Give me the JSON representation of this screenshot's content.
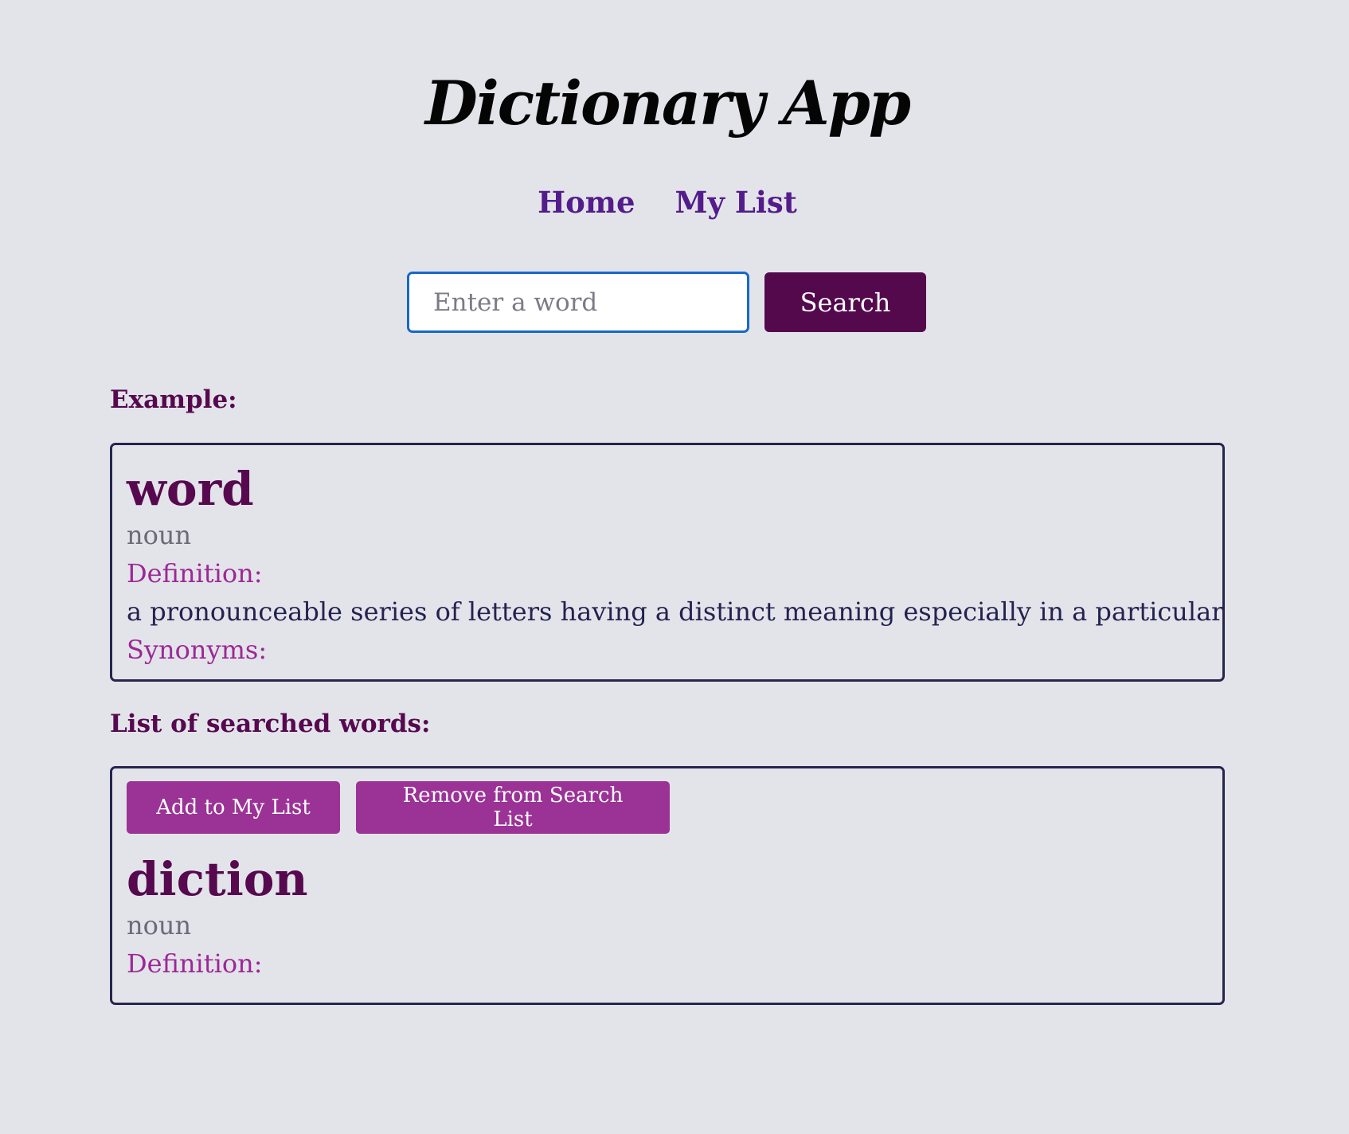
{
  "header": {
    "title": "Dictionary App"
  },
  "nav": {
    "items": [
      {
        "label": "Home"
      },
      {
        "label": "My List"
      }
    ]
  },
  "search": {
    "value": "",
    "placeholder": "Enter a word",
    "button_label": "Search"
  },
  "example": {
    "heading": "Example:",
    "word": "word",
    "part_of_speech": "noun",
    "definition_label": "Definition:",
    "definition": "a pronounceable series of letters having a distinct meaning especially in a particular field",
    "synonyms_label": "Synonyms:"
  },
  "searched": {
    "heading": "List of searched words:",
    "add_button": "Add to My List",
    "remove_button": "Remove from Search List",
    "entries": [
      {
        "word": "diction",
        "part_of_speech": "noun",
        "definition_label": "Definition:"
      }
    ]
  },
  "colors": {
    "background": "#e3e4ea",
    "nav_link": "#541c8b",
    "primary": "#54094d",
    "accent": "#9b3296",
    "label": "#9c2896",
    "text": "#232350",
    "border": "#25254f",
    "input_focus": "#1868c8"
  }
}
